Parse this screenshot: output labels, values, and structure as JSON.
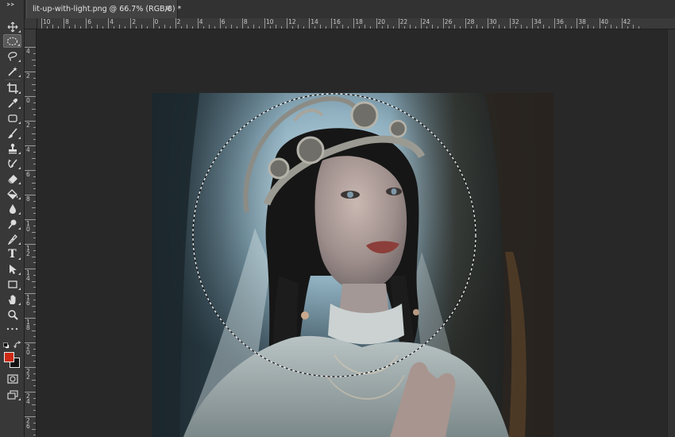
{
  "document": {
    "tab_title": "lit-up-with-light.png @ 66.7% (RGB/8) *",
    "close_glyph": "×"
  },
  "rulers": {
    "top_labels": [
      "10",
      "8",
      "6",
      "4",
      "2",
      "0",
      "2",
      "4",
      "6",
      "8",
      "10",
      "12",
      "14",
      "16",
      "18",
      "20",
      "22",
      "24",
      "26",
      "28",
      "30",
      "32",
      "34",
      "36",
      "38",
      "40",
      "42"
    ],
    "left_labels": [
      "4",
      "2",
      "0",
      "2",
      "4",
      "6",
      "8",
      "10",
      "12",
      "14",
      "16",
      "18",
      "20",
      "22",
      "24",
      "26"
    ]
  },
  "tools": [
    {
      "name": "move-tool",
      "icon": "move-icon"
    },
    {
      "name": "elliptical-marquee-tool",
      "icon": "ellipse-marquee-icon",
      "active": true
    },
    {
      "name": "lasso-tool",
      "icon": "lasso-icon"
    },
    {
      "name": "magic-wand-tool",
      "icon": "magic-wand-icon"
    },
    {
      "name": "crop-tool",
      "icon": "crop-icon"
    },
    {
      "name": "eyedropper-tool",
      "icon": "eyedropper-icon"
    },
    {
      "name": "frame-tool",
      "icon": "frame-icon"
    },
    {
      "name": "brush-tool",
      "icon": "brush-icon"
    },
    {
      "name": "stamp-tool",
      "icon": "stamp-icon"
    },
    {
      "name": "history-brush-tool",
      "icon": "history-brush-icon"
    },
    {
      "name": "eraser-tool",
      "icon": "eraser-icon"
    },
    {
      "name": "paint-bucket-tool",
      "icon": "paint-bucket-icon"
    },
    {
      "name": "blur-tool",
      "icon": "blur-drop-icon"
    },
    {
      "name": "dodge-tool",
      "icon": "dodge-icon"
    },
    {
      "name": "pen-tool",
      "icon": "pen-icon"
    },
    {
      "name": "type-tool",
      "icon": "type-icon",
      "label": "T"
    },
    {
      "name": "path-selection-tool",
      "icon": "path-select-icon"
    },
    {
      "name": "rectangle-tool",
      "icon": "rectangle-icon"
    },
    {
      "name": "hand-tool",
      "icon": "hand-icon"
    },
    {
      "name": "zoom-tool",
      "icon": "zoom-icon"
    }
  ],
  "colors": {
    "foreground": "#cc2a14",
    "background": "#111111",
    "selection_accent": "#ffffff"
  }
}
